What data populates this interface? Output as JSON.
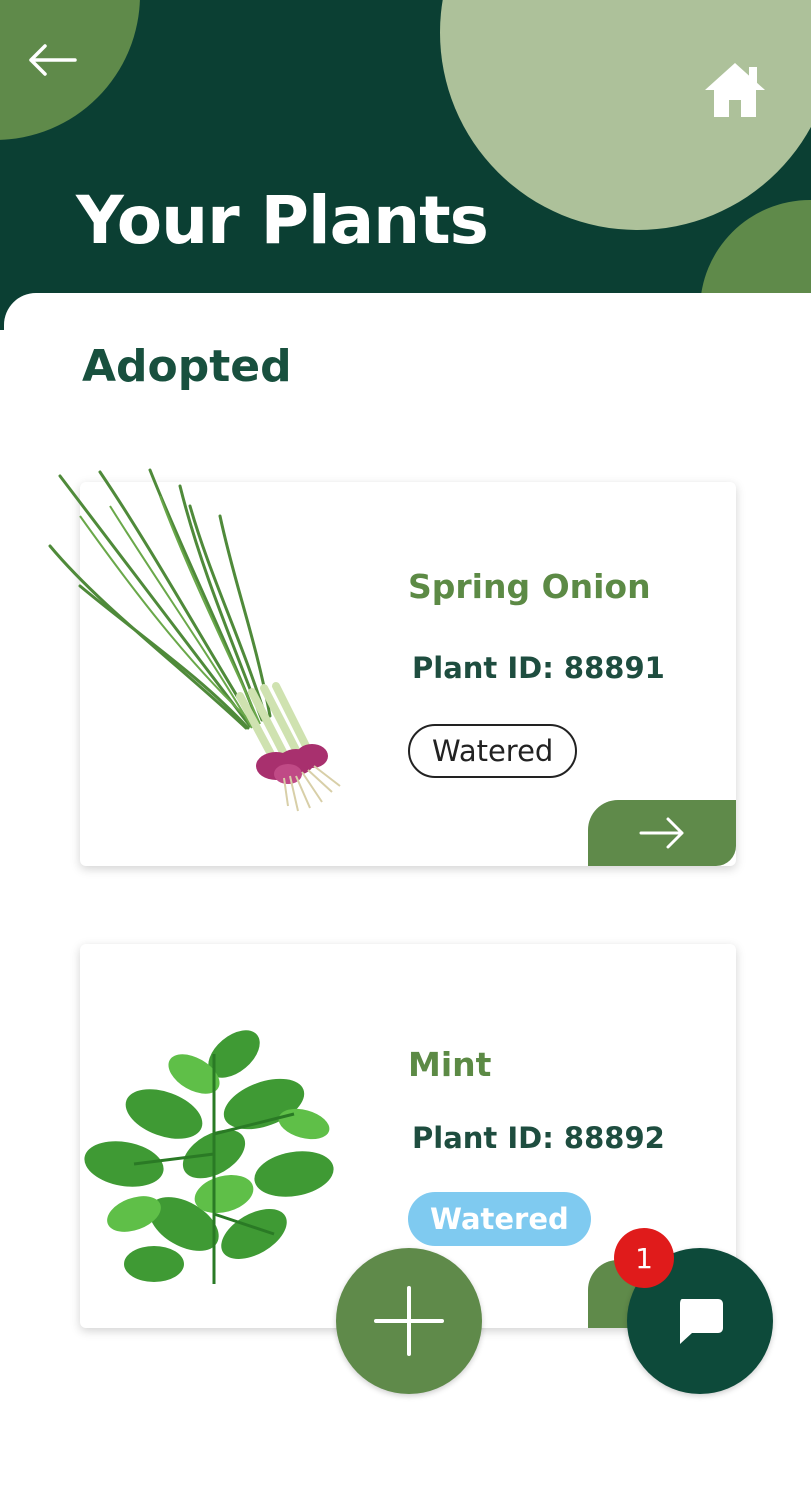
{
  "header": {
    "title": "Your Plants",
    "back_icon": "arrow-left-icon",
    "home_icon": "home-icon"
  },
  "section": {
    "title": "Adopted"
  },
  "plants": [
    {
      "name": "Spring Onion",
      "plant_id": "Plant ID: 88891",
      "status": "Watered",
      "status_style": "outline",
      "image": "spring-onion-image"
    },
    {
      "name": "Mint",
      "plant_id": "Plant ID: 88892",
      "status": "Watered",
      "status_style": "filled",
      "image": "mint-image"
    }
  ],
  "fab": {
    "add_icon": "plus-icon",
    "chat_icon": "chat-icon",
    "chat_badge": "1"
  },
  "colors": {
    "header_bg": "#0b3f33",
    "accent_green": "#5f8a4a",
    "light_green": "#adc19a",
    "title_green": "#18503e",
    "plant_name_green": "#5c8a45",
    "badge_blue": "#7fcaf0",
    "notification_red": "#e01b1b"
  }
}
